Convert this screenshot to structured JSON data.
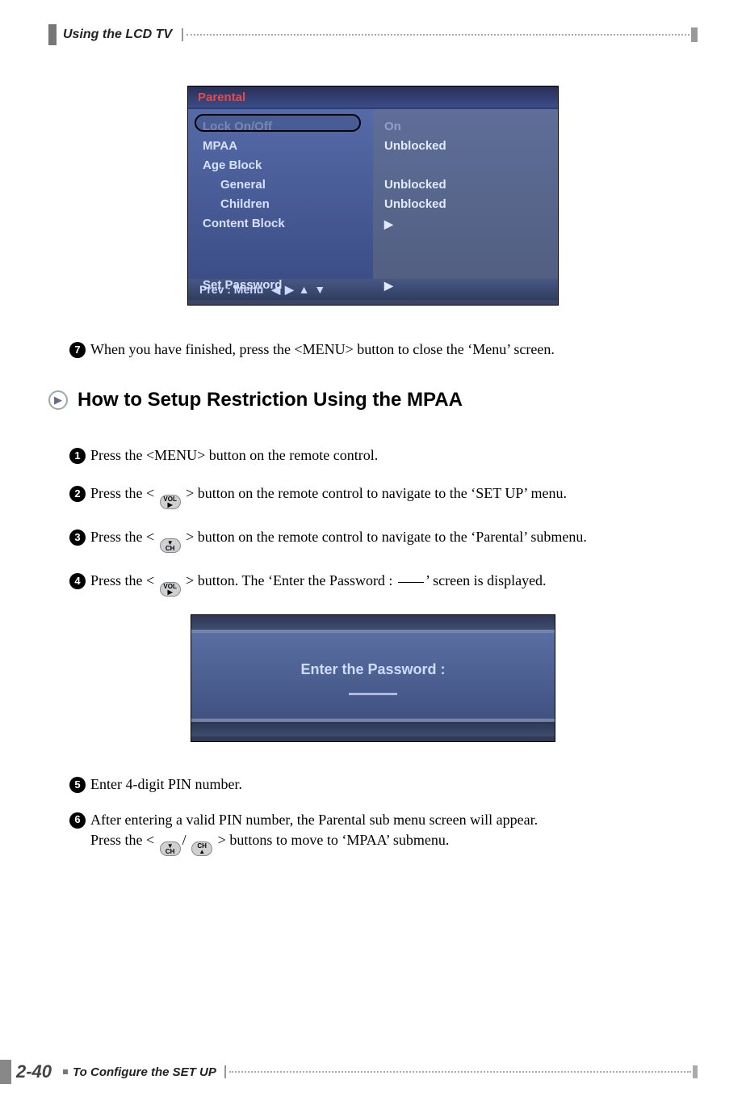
{
  "header": {
    "title": "Using the LCD TV"
  },
  "osd": {
    "title": "Parental",
    "rows_left": {
      "lock": "Lock On/Off",
      "mpaa": "MPAA",
      "age": "Age Block",
      "general": "General",
      "children": "Children",
      "content": "Content Block",
      "setpw": "Set Password"
    },
    "rows_right": {
      "lock": "On",
      "mpaa": "Unblocked",
      "general": "Unblocked",
      "children": "Unblocked",
      "content": "▶",
      "setpw": "▶"
    },
    "prev": "Prev :   Menu",
    "prev_icons": "◀ ▶ ▲ ▼"
  },
  "step7": "When you have finished, press the <MENU> button to close the ‘Menu’ screen.",
  "section_title": "How to Setup Restriction Using the MPAA",
  "steps": {
    "s1": "Press the <MENU> button on the remote control.",
    "s2a": "Press the < ",
    "s2b": " > button on the remote control to navigate to the ‘SET UP’ menu.",
    "s3a": "Press the < ",
    "s3b": " > button on the remote control to navigate to the ‘Parental’ submenu.",
    "s4a": "Press the < ",
    "s4b": "> button. The ‘Enter the Password : ",
    "s4c": "’ screen is displayed.",
    "s5": "Enter 4-digit PIN number.",
    "s6a": "After entering a valid PIN number, the Parental sub menu screen will appear.",
    "s6b1": "Press the <",
    "s6b2": "> buttons to move to ‘MPAA’ submenu."
  },
  "passbox": {
    "label": "Enter the Password :"
  },
  "footer": {
    "page": "2-40",
    "label": "To Configure the SET UP"
  },
  "icons": {
    "vol_right": {
      "top": "VOL",
      "bot": "▶"
    },
    "ch_down": {
      "top": "▼",
      "bot": "CH"
    },
    "ch_up": {
      "top": "CH",
      "bot": "▲"
    }
  }
}
